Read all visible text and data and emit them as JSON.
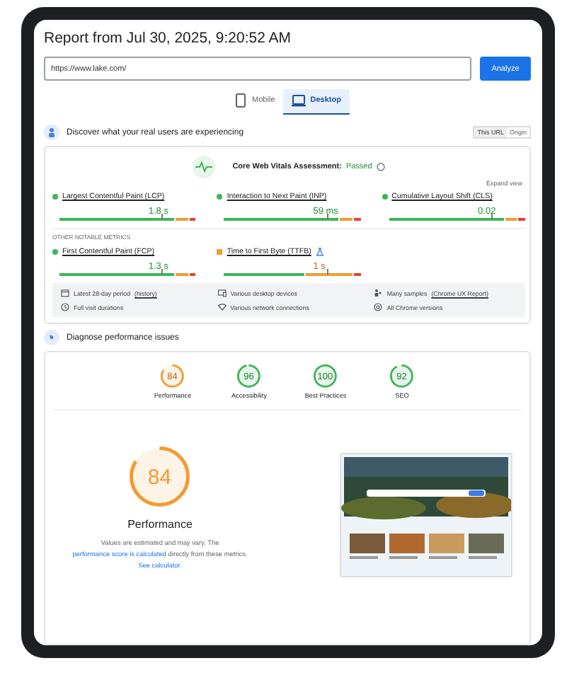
{
  "report_title": "Report from Jul 30, 2025, 9:20:52 AM",
  "url_field": {
    "value": "https://www.lake.com/"
  },
  "analyze_button": "Analyze",
  "device_tabs": [
    {
      "label": "Mobile",
      "kind": "phone",
      "selected": false
    },
    {
      "label": "Desktop",
      "kind": "laptop",
      "selected": true
    }
  ],
  "field_section": {
    "title": "Discover what your real users are experiencing",
    "scope_toggle": [
      {
        "label": "This URL",
        "selected": true
      },
      {
        "label": "Origin",
        "selected": false
      }
    ],
    "assessment_label": "Core Web Vitals Assessment:",
    "assessment_result": "Passed",
    "expand_link": "Expand view",
    "core_metrics": [
      {
        "name": "Largest Contentful Paint (LCP)",
        "value": "1.8 s",
        "color": "#3cb55a"
      },
      {
        "name": "Interaction to Next Paint (INP)",
        "value": "59 ms",
        "color": "#3cb55a"
      },
      {
        "name": "Cumulative Layout Shift (CLS)",
        "value": "0.02",
        "color": "#3cb55a"
      }
    ],
    "other_heading": "OTHER NOTABLE METRICS",
    "other_metrics": [
      {
        "name": "First Contentful Paint (FCP)",
        "value": "1.3 s",
        "color": "#3cb55a",
        "info": false
      },
      {
        "name": "Time to First Byte (TTFB)",
        "value": "1 s",
        "color": "#f29b31",
        "info": true
      }
    ],
    "facts": [
      {
        "kind": "calendar",
        "text": "Latest 28-day period",
        "extra": "(history)"
      },
      {
        "kind": "devices",
        "text": "Various desktop devices"
      },
      {
        "kind": "people",
        "text": "Many samples",
        "extra": "(Chrome UX Report)"
      },
      {
        "kind": "clock",
        "text": "Full visit durations"
      },
      {
        "kind": "wifi",
        "text": "Various network connections"
      },
      {
        "kind": "chrome",
        "text": "All Chrome versions"
      }
    ]
  },
  "lab_section": {
    "title": "Diagnose performance issues",
    "scores": [
      {
        "score": "84",
        "label": "Performance",
        "color": "#f29b31"
      },
      {
        "score": "96",
        "label": "Accessibility",
        "color": "#3cb55a"
      },
      {
        "score": "100",
        "label": "Best Practices",
        "color": "#3cb55a"
      },
      {
        "score": "92",
        "label": "SEO",
        "color": "#3cb55a"
      }
    ],
    "big_score": {
      "score": "84",
      "color": "#f29b31",
      "label": "Performance"
    },
    "note": [
      {
        "kind": "text",
        "text": "Values are estimated and may vary. The"
      },
      {
        "kind": "link",
        "text": "performance score is calculated"
      },
      {
        "kind": "text",
        "text": "directly from these metrics."
      },
      {
        "kind": "link",
        "text": "See calculator."
      }
    ]
  }
}
